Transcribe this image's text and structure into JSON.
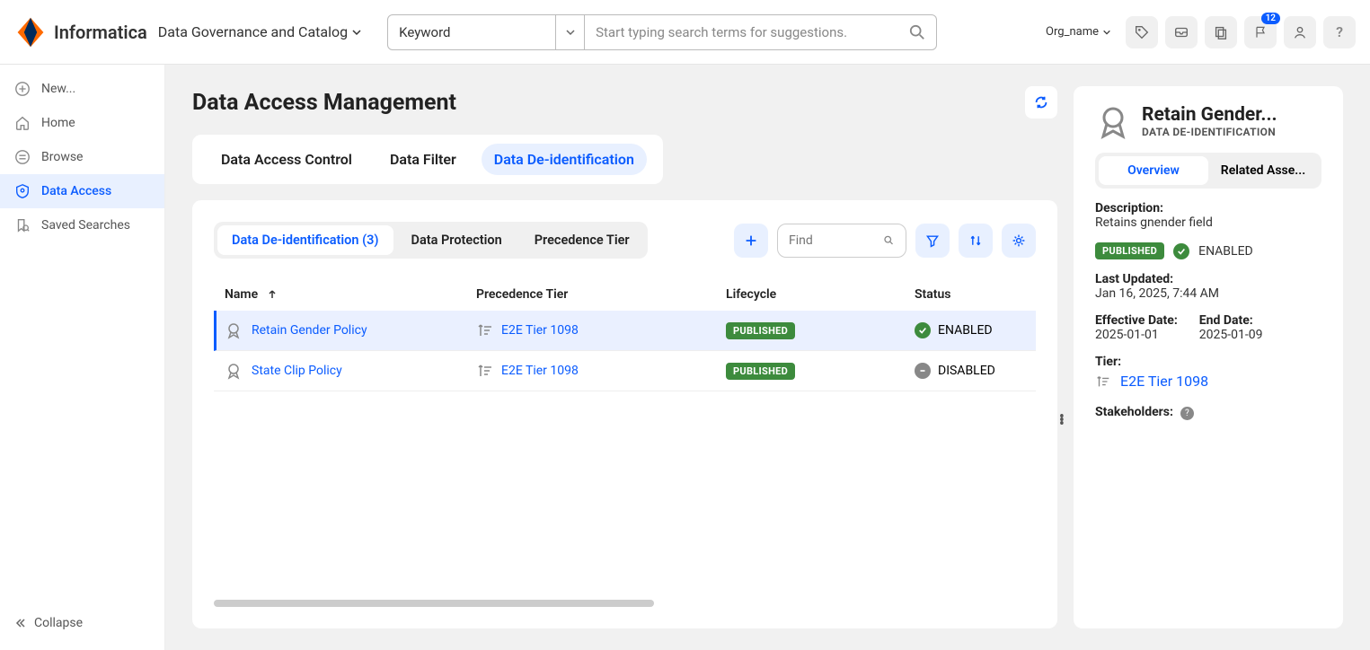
{
  "header": {
    "brand": "Informatica",
    "appName": "Data Governance and Catalog",
    "keywordLabel": "Keyword",
    "searchPlaceholder": "Start typing search terms for suggestions.",
    "orgName": "Org_name",
    "notificationBadge": "12"
  },
  "sidebar": {
    "items": [
      {
        "label": "New...",
        "icon": "plus"
      },
      {
        "label": "Home",
        "icon": "home"
      },
      {
        "label": "Browse",
        "icon": "list"
      },
      {
        "label": "Data Access",
        "icon": "shield",
        "active": true
      },
      {
        "label": "Saved Searches",
        "icon": "bookmark"
      }
    ],
    "collapse": "Collapse"
  },
  "page": {
    "title": "Data Access Management",
    "tabs": [
      "Data Access Control",
      "Data Filter",
      "Data De-identification"
    ],
    "activeTab": 2
  },
  "content": {
    "subtabs": [
      {
        "label": "Data De-identification (3)",
        "active": true
      },
      {
        "label": "Data Protection"
      },
      {
        "label": "Precedence Tier"
      }
    ],
    "findPlaceholder": "Find",
    "columns": [
      "Name",
      "Precedence Tier",
      "Lifecycle",
      "Status"
    ],
    "rows": [
      {
        "name": "Retain Gender Policy",
        "tier": "E2E Tier 1098",
        "lifecycle": "PUBLISHED",
        "status": "ENABLED",
        "selected": true
      },
      {
        "name": "State Clip Policy",
        "tier": "E2E Tier 1098",
        "lifecycle": "PUBLISHED",
        "status": "DISABLED"
      }
    ]
  },
  "detail": {
    "title": "Retain Gender...",
    "subtitle": "DATA DE-IDENTIFICATION",
    "tabs": [
      "Overview",
      "Related Asse..."
    ],
    "activeTab": 0,
    "descriptionLabel": "Description:",
    "description": "Retains gnender field",
    "lifecycleBadge": "PUBLISHED",
    "statusBadge": "ENABLED",
    "lastUpdatedLabel": "Last Updated:",
    "lastUpdated": "Jan 16, 2025, 7:44 AM",
    "effectiveDateLabel": "Effective Date:",
    "effectiveDate": "2025-01-01",
    "endDateLabel": "End Date:",
    "endDate": "2025-01-09",
    "tierLabel": "Tier:",
    "tier": "E2E Tier 1098",
    "stakeholdersLabel": "Stakeholders:"
  }
}
